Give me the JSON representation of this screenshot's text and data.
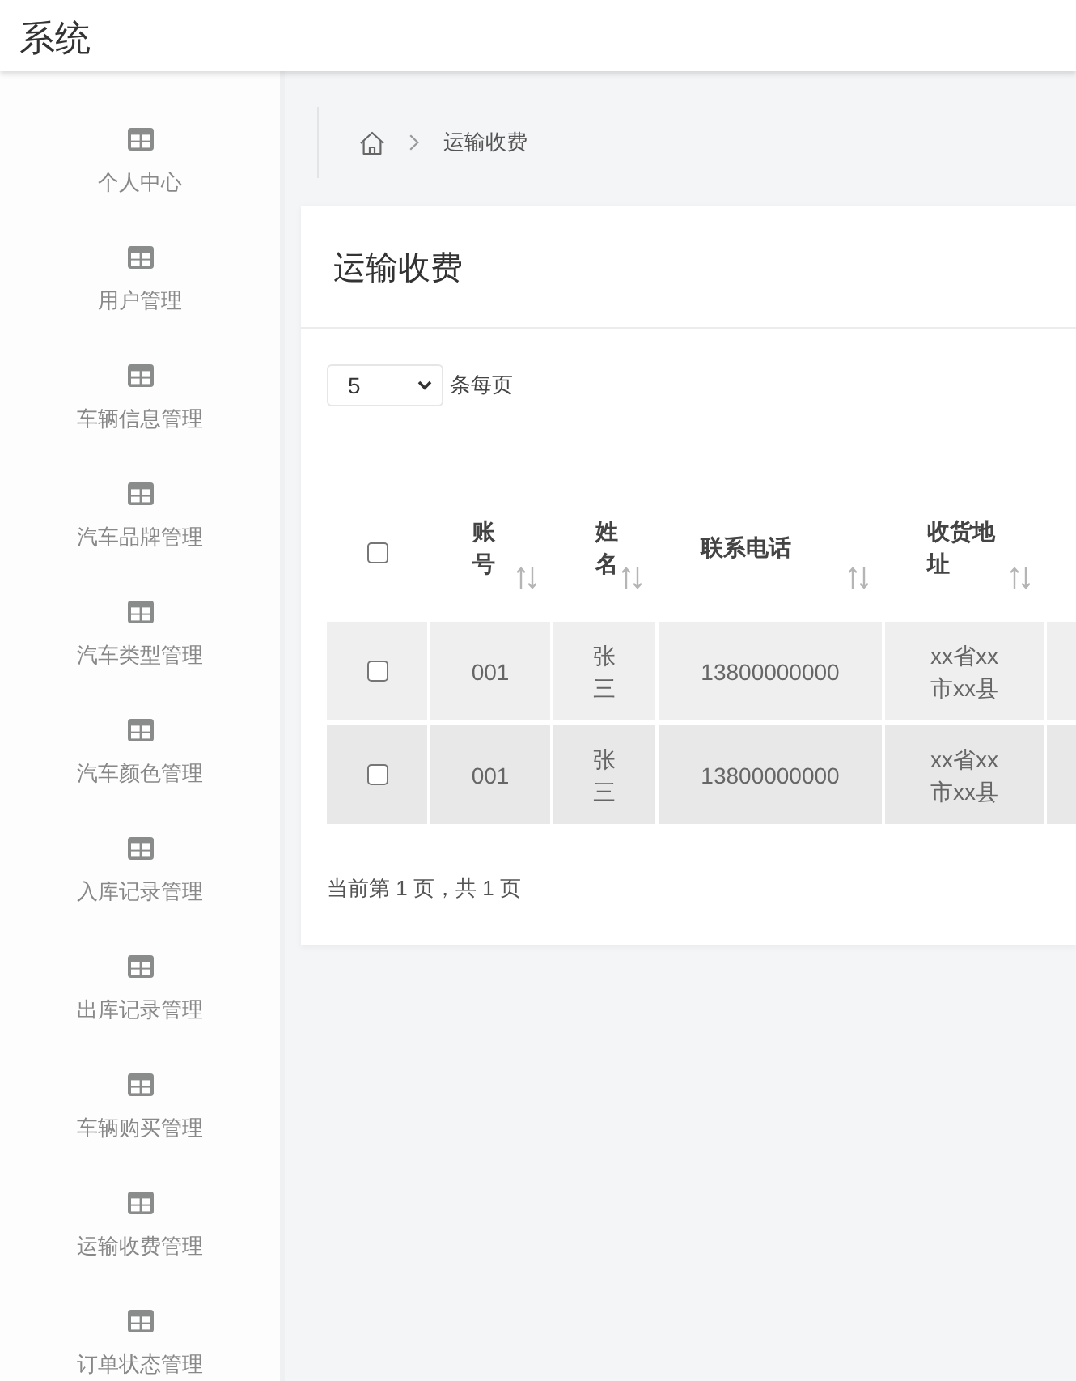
{
  "header": {
    "title": "系统"
  },
  "sidebar": {
    "items": [
      {
        "label": "个人中心",
        "selected": false
      },
      {
        "label": "用户管理",
        "selected": false
      },
      {
        "label": "车辆信息管理",
        "selected": false
      },
      {
        "label": "汽车品牌管理",
        "selected": false
      },
      {
        "label": "汽车类型管理",
        "selected": false
      },
      {
        "label": "汽车颜色管理",
        "selected": false
      },
      {
        "label": "入库记录管理",
        "selected": false
      },
      {
        "label": "出库记录管理",
        "selected": false
      },
      {
        "label": "车辆购买管理",
        "selected": false
      },
      {
        "label": "运输收费管理",
        "selected": false
      },
      {
        "label": "订单状态管理",
        "selected": false
      }
    ]
  },
  "breadcrumb": {
    "current": "运输收费"
  },
  "card": {
    "title": "运输收费"
  },
  "page_size": {
    "value": "5",
    "suffix": "条每页"
  },
  "table": {
    "header_checkbox": {
      "checked": false
    },
    "columns": [
      {
        "label": "账号",
        "sortable": true
      },
      {
        "label": "姓名",
        "sortable": true
      },
      {
        "label": "联系电话",
        "sortable": true
      },
      {
        "label": "收货地址",
        "sortable": true
      }
    ],
    "rows": [
      {
        "checked": false,
        "cells": [
          "001",
          "张三",
          "13800000000",
          "xx省xx市xx县"
        ]
      },
      {
        "checked": false,
        "cells": [
          "001",
          "张三",
          "13800000000",
          "xx省xx市xx县"
        ]
      }
    ]
  },
  "pagination": {
    "text": "当前第 1 页，共 1 页"
  }
}
